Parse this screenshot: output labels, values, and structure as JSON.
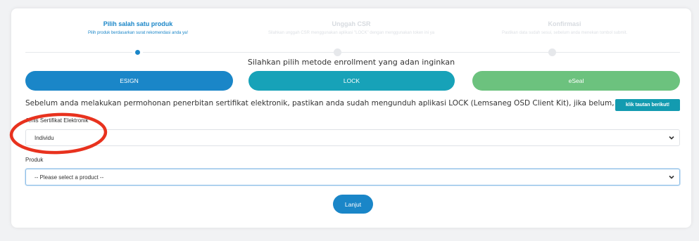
{
  "stepper": {
    "steps": [
      {
        "title": "Pilih salah satu produk",
        "desc": "Pilih produk berdasarkan surat rekomendasi anda ya!"
      },
      {
        "title": "Unggah CSR",
        "desc": "Silahkan unggah CSR menggunakan aplikasi \"LOCK\" dengan menggunakan token ini ya"
      },
      {
        "title": "Konfirmasi",
        "desc": "Pastikan data sudah sesui, sebelum anda menekan tombol submit."
      }
    ]
  },
  "enrollment": {
    "heading": "Silahkan pilih metode enrollment yang adan inginkan",
    "methods": [
      {
        "label": "ESIGN",
        "color": "#1a86c8"
      },
      {
        "label": "LOCK",
        "color": "#17a2b8"
      },
      {
        "label": "eSeal",
        "color": "#6cc27e"
      }
    ]
  },
  "notice": {
    "text": "Sebelum anda melakukan permohonan penerbitan sertifikat elektronik, pastikan anda sudah mengunduh aplikasi LOCK (Lemsaneg OSD Client Kit), jika belum,",
    "link_label": "klik tautan berikut!"
  },
  "form": {
    "certificate_type": {
      "label": "Jenis Sertifikat Elektronik",
      "value": "Individu"
    },
    "product": {
      "label": "Produk",
      "value": "-- Please select a product --"
    }
  },
  "submit_label": "Lanjut",
  "colors": {
    "primary": "#1a86c8",
    "annotation": "#e8321e"
  }
}
